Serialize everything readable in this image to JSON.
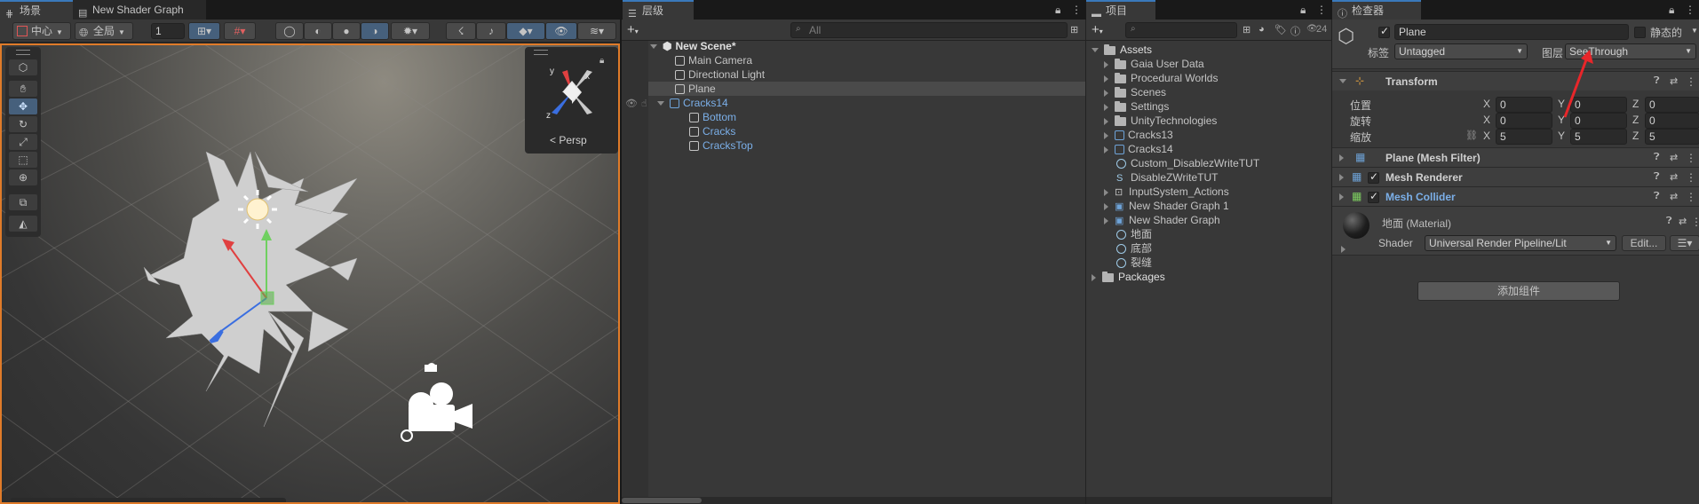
{
  "tabs": {
    "scene": "场景",
    "shader_graph": "New Shader Graph",
    "hierarchy": "层级",
    "project": "项目",
    "inspector": "检查器"
  },
  "scene_toolbar": {
    "pivot": "中心",
    "space": "全局",
    "grid_value": "1"
  },
  "scene_view": {
    "persp_label": "Persp",
    "gizmo_y": "y",
    "gizmo_x": "x",
    "gizmo_z": "z"
  },
  "hierarchy": {
    "search_placeholder": "All",
    "scene_name": "New Scene*",
    "items": [
      {
        "label": "Main Camera"
      },
      {
        "label": "Directional Light"
      },
      {
        "label": "Plane"
      },
      {
        "label": "Cracks14"
      },
      {
        "label": "Bottom"
      },
      {
        "label": "Cracks"
      },
      {
        "label": "CracksTop"
      }
    ]
  },
  "project": {
    "count": "24",
    "root": "Assets",
    "items": [
      {
        "label": "Gaia User Data"
      },
      {
        "label": "Procedural Worlds"
      },
      {
        "label": "Scenes"
      },
      {
        "label": "Settings"
      },
      {
        "label": "UnityTechnologies"
      },
      {
        "label": "Cracks13"
      },
      {
        "label": "Cracks14"
      },
      {
        "label": "Custom_DisablezWriteTUT"
      },
      {
        "label": "DisableZWriteTUT"
      },
      {
        "label": "InputSystem_Actions"
      },
      {
        "label": "New Shader Graph 1"
      },
      {
        "label": "New Shader Graph"
      },
      {
        "label": "地面"
      },
      {
        "label": "底部"
      },
      {
        "label": "裂缝"
      }
    ],
    "packages": "Packages"
  },
  "inspector": {
    "object_name": "Plane",
    "static_label": "静态的",
    "tag_label": "标签",
    "tag_value": "Untagged",
    "layer_label": "图层",
    "layer_value": "SeeThrough",
    "transform": {
      "title": "Transform",
      "position_label": "位置",
      "rotation_label": "旋转",
      "scale_label": "缩放",
      "axis_x": "X",
      "axis_y": "Y",
      "axis_z": "Z",
      "position": [
        "0",
        "0",
        "0"
      ],
      "rotation": [
        "0",
        "0",
        "0"
      ],
      "scale": [
        "5",
        "5",
        "5"
      ]
    },
    "mesh_filter": "Plane (Mesh Filter)",
    "mesh_renderer": "Mesh Renderer",
    "mesh_collider": "Mesh Collider",
    "material_name": "地面 (Material)",
    "shader_label": "Shader",
    "shader_value": "Universal Render Pipeline/Lit",
    "edit_button": "Edit...",
    "add_component": "添加组件"
  }
}
